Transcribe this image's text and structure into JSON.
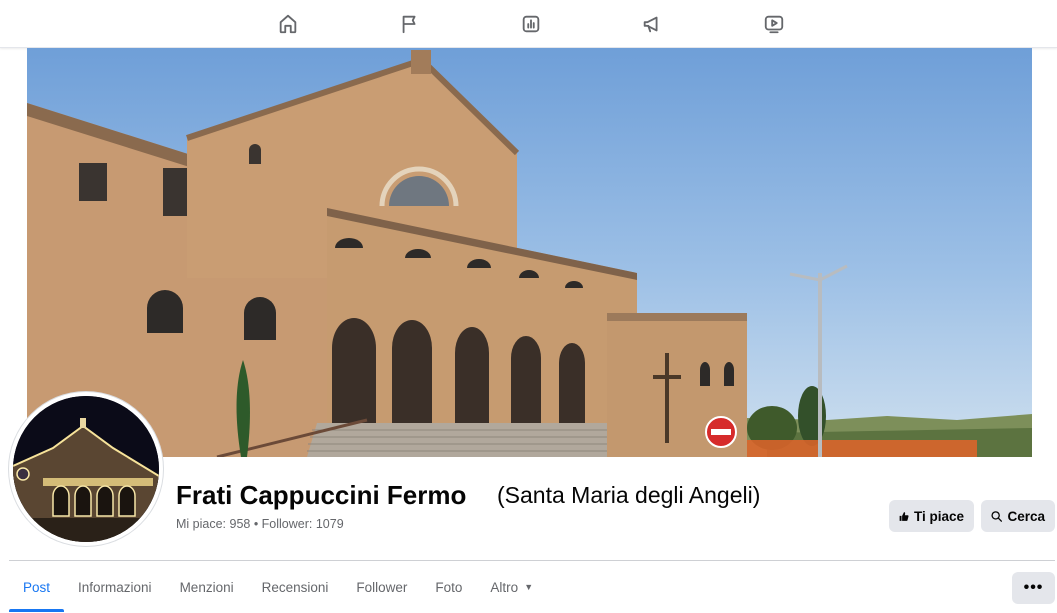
{
  "topnav": {
    "items": [
      {
        "icon": "home-icon"
      },
      {
        "icon": "flag-icon"
      },
      {
        "icon": "insights-icon"
      },
      {
        "icon": "megaphone-icon"
      },
      {
        "icon": "video-icon"
      }
    ]
  },
  "page": {
    "name": "Frati Cappuccini Fermo",
    "subtitle": "(Santa Maria degli Angeli)",
    "stats": "Mi piace: 958 • Follower: 1079"
  },
  "actions": {
    "like_label": "Ti piace",
    "search_label": "Cerca",
    "more_label": "•••"
  },
  "tabs": [
    {
      "label": "Post",
      "active": true
    },
    {
      "label": "Informazioni"
    },
    {
      "label": "Menzioni"
    },
    {
      "label": "Recensioni"
    },
    {
      "label": "Follower"
    },
    {
      "label": "Foto"
    },
    {
      "label": "Altro"
    }
  ],
  "colors": {
    "accent": "#1877f2",
    "button_bg": "#e4e6eb",
    "secondary_text": "#65676b"
  }
}
